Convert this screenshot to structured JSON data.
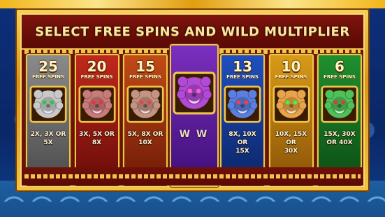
{
  "title": "SELECT FREE SPINS AND WILD MULTIPLIER",
  "options": [
    {
      "count": "25",
      "label": "FREE SPINS",
      "mult": "2X, 3X OR\n5X",
      "color": "#8a8a8a",
      "color2": "#4b4b4b",
      "lion": "#c9c9c9",
      "eyes": "#22cc44"
    },
    {
      "count": "20",
      "label": "FREE SPINS",
      "mult": "3X, 5X OR\n8X",
      "color": "#c0281c",
      "color2": "#6a0c08",
      "lion": "#c87b7b",
      "eyes": "#e33"
    },
    {
      "count": "15",
      "label": "FREE SPINS",
      "mult": "5X, 8X OR\n10X",
      "color": "#c24a16",
      "color2": "#6e1a06",
      "lion": "#c59384",
      "eyes": "#e44"
    },
    {
      "count": "",
      "label": "",
      "mult": "W W",
      "color": "#7b2fbf",
      "color2": "#3e0e78",
      "lion": "#b34ad6",
      "eyes": "#ff5ad0",
      "selected": true
    },
    {
      "count": "13",
      "label": "FREE SPINS",
      "mult": "8X, 10X OR\n15X",
      "color": "#1f4fbf",
      "color2": "#0b2566",
      "lion": "#5b7fe0",
      "eyes": "#ff3b3b"
    },
    {
      "count": "10",
      "label": "FREE SPINS",
      "mult": "10X, 15X OR\n30X",
      "color": "#d89a17",
      "color2": "#8a5206",
      "lion": "#e8a44a",
      "eyes": "#3f3"
    },
    {
      "count": "6",
      "label": "FREE SPINS",
      "mult": "15X, 30X\nOR 40X",
      "color": "#1f8f2e",
      "color2": "#0c4d14",
      "lion": "#4fc15a",
      "eyes": "#e33"
    }
  ]
}
